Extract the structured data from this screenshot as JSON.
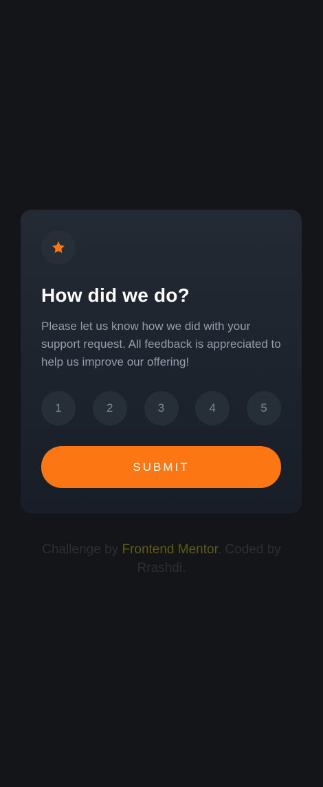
{
  "card": {
    "icon": "star-icon",
    "title": "How did we do?",
    "description": "Please let us know how we did with your support request. All feedback is appreciated to help us improve our offering!",
    "ratings": [
      "1",
      "2",
      "3",
      "4",
      "5"
    ],
    "submit_label": "SUBMIT"
  },
  "attribution": {
    "prefix": "Challenge by ",
    "link_text": "Frontend Mentor",
    "middle": ". Coded by",
    "author": "Rrashdi."
  },
  "colors": {
    "background": "#131518",
    "accent": "#fc7614",
    "text_muted": "#959eac"
  }
}
